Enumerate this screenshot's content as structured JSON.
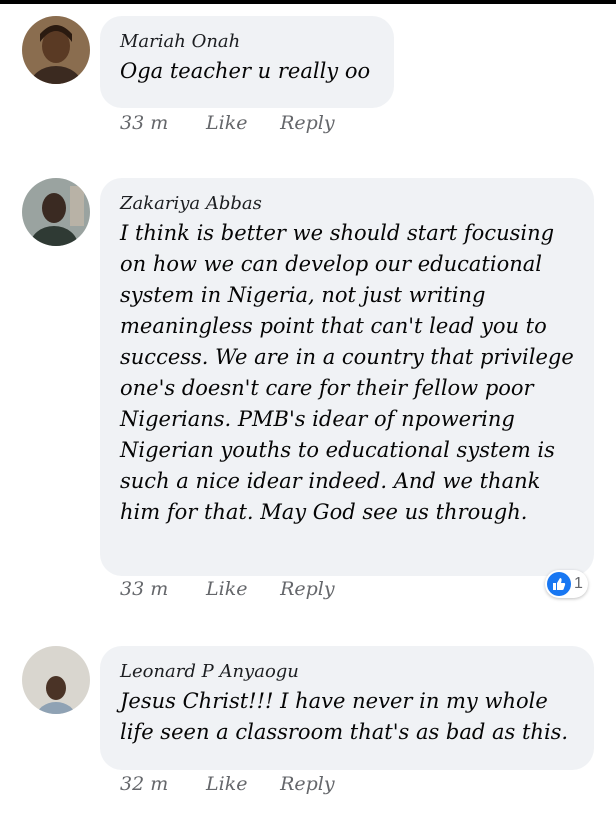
{
  "comments": [
    {
      "author": "Mariah Onah",
      "text": "Oga teacher u really oo",
      "time": "33 m",
      "like_label": "Like",
      "reply_label": "Reply"
    },
    {
      "author": "Zakariya Abbas",
      "text": "I think is better we should start focusing on how we can develop our educational system in Nigeria, not just writing meaningless point that can't lead you to success. We are in a country that privilege one's doesn't care for their fellow poor Nigerians. PMB's idear of npowering Nigerian youths to educational system is such a nice idear indeed. And we thank him for that. May God see us through.",
      "time": "33 m",
      "like_label": "Like",
      "reply_label": "Reply",
      "reaction_count": "1",
      "reaction_icon": "like-reaction-icon"
    },
    {
      "author": "Leonard P Anyaogu",
      "text": "Jesus Christ!!!  I have never in my whole life seen a classroom that's as bad as this.",
      "time": "32 m",
      "like_label": "Like",
      "reply_label": "Reply"
    }
  ],
  "colors": {
    "bubble": "#f0f2f5",
    "meta": "#65676b",
    "accent": "#1877f2"
  }
}
